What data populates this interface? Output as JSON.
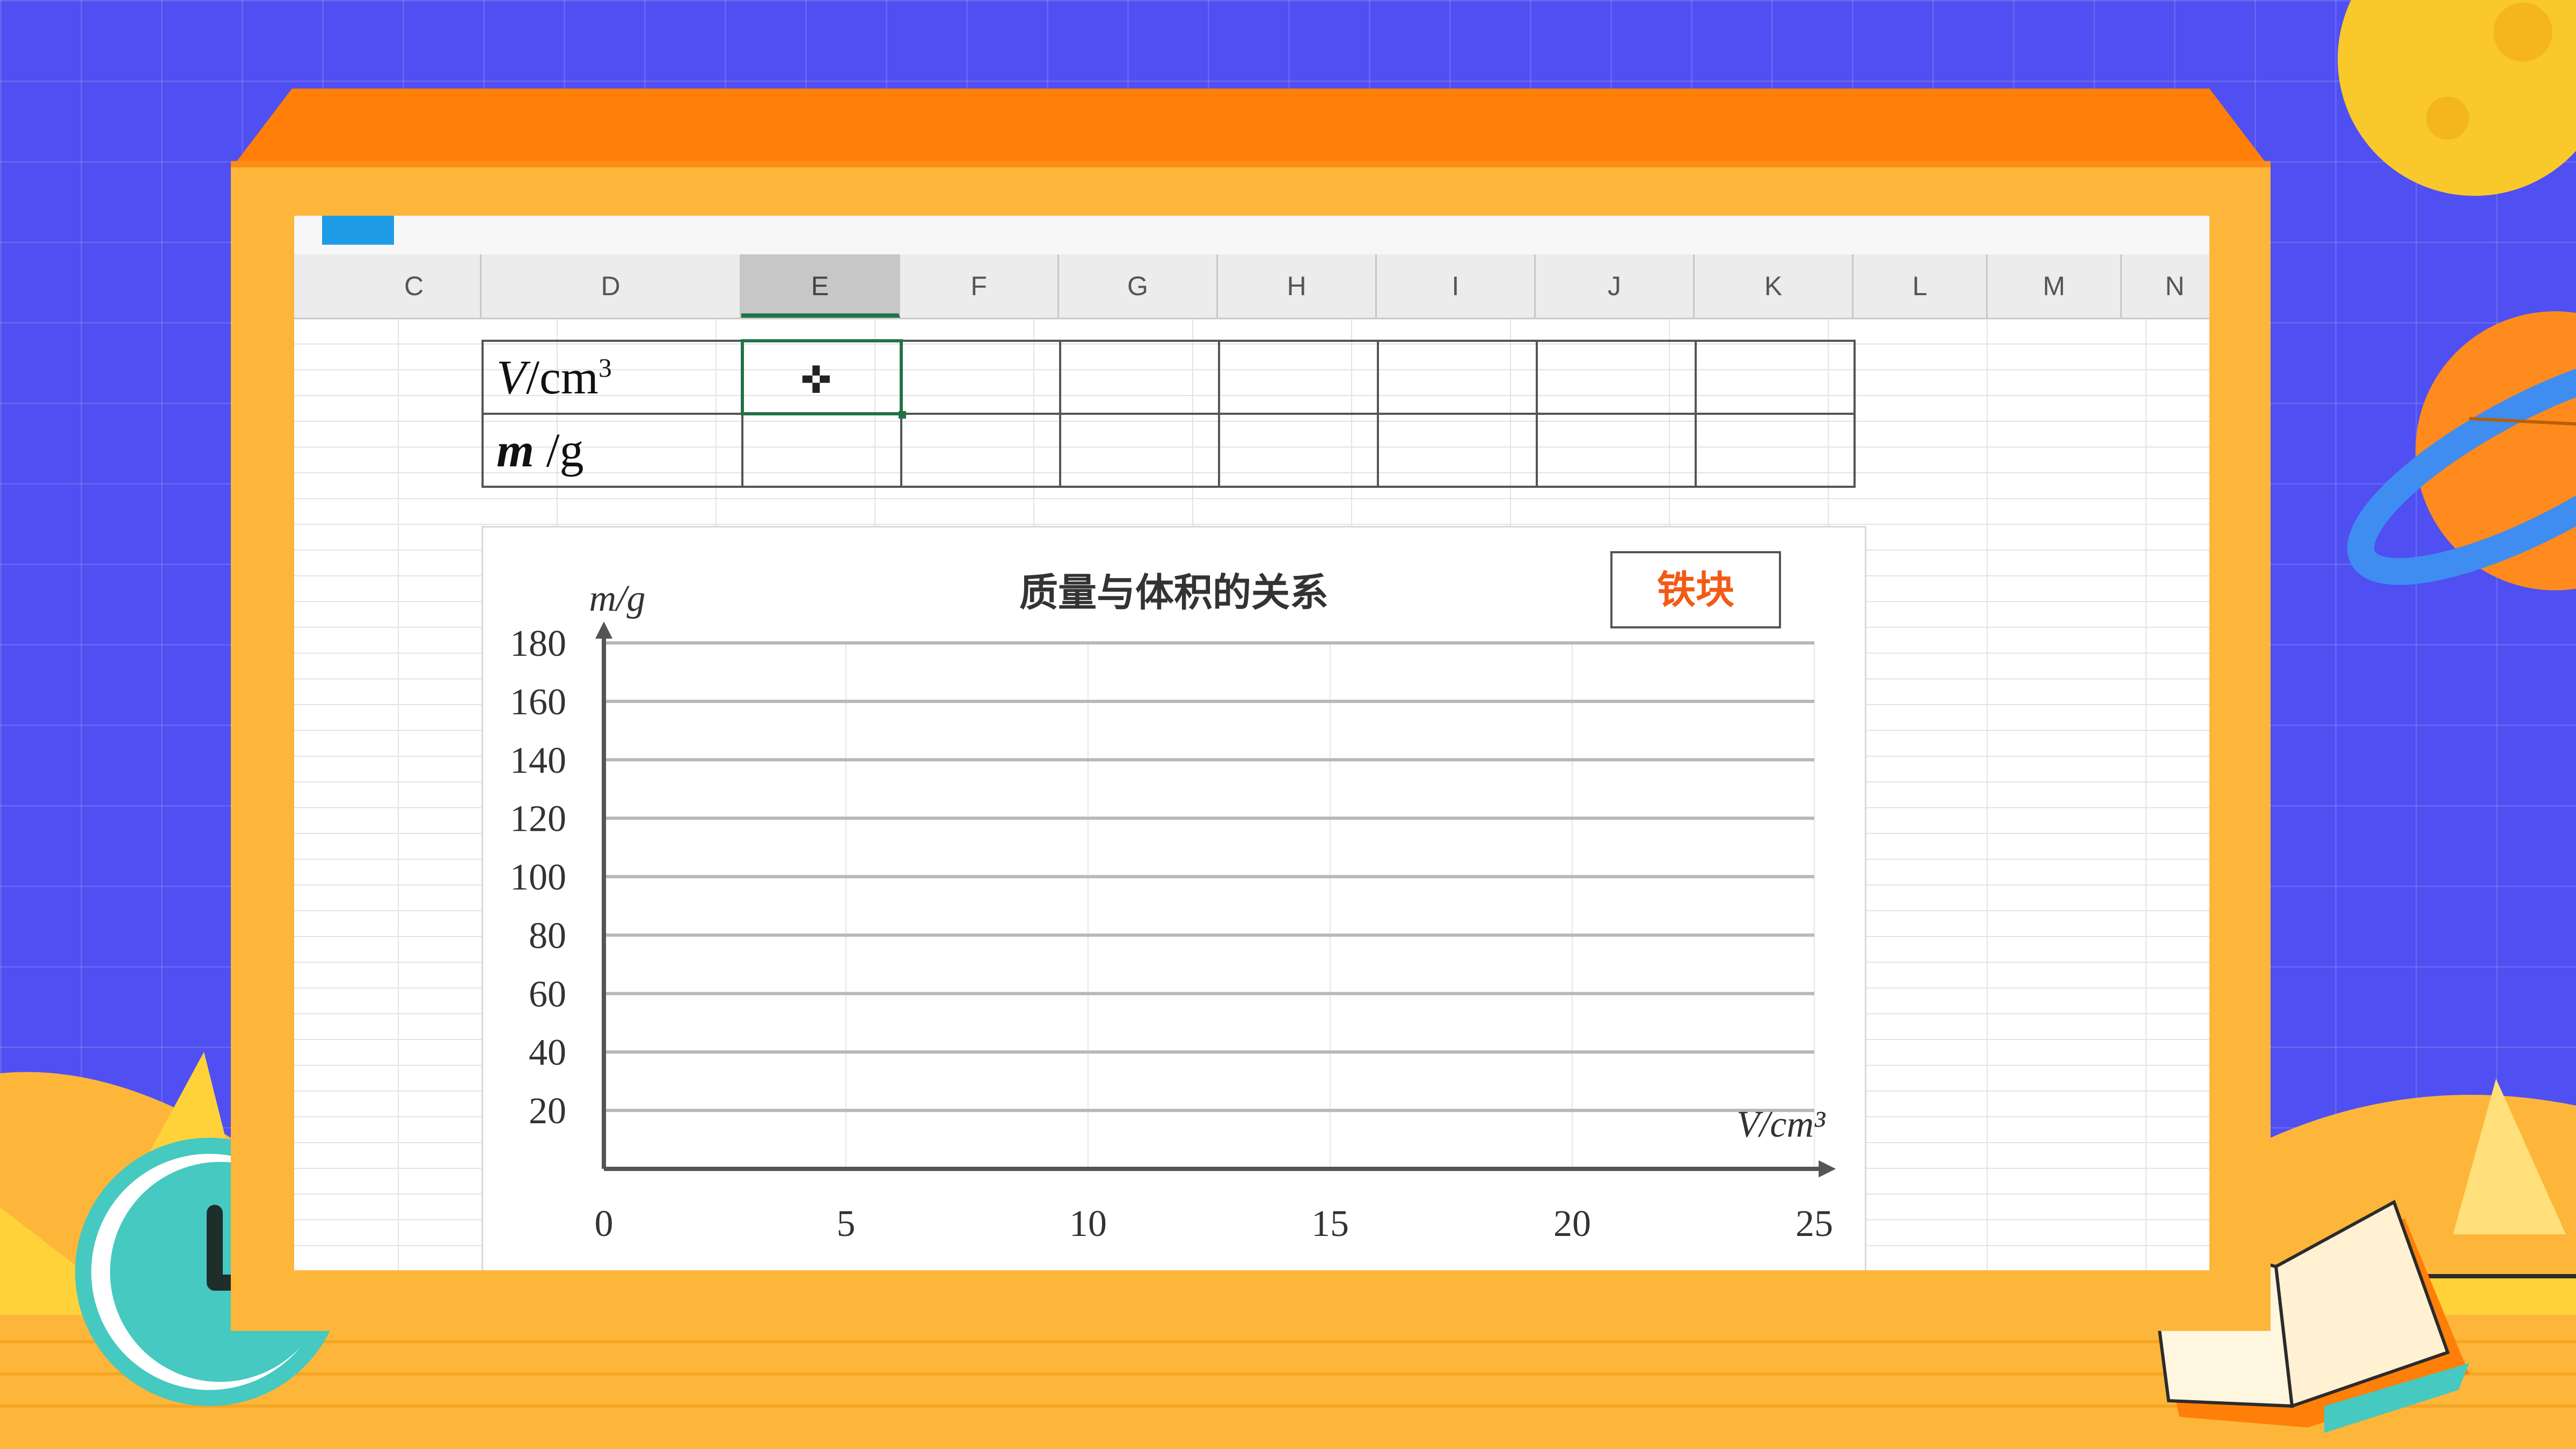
{
  "column_headers": [
    "C",
    "D",
    "E",
    "F",
    "G",
    "H",
    "I",
    "J",
    "K",
    "L",
    "M",
    "N"
  ],
  "active_column": "E",
  "data_table": {
    "row1_label": {
      "var": "V",
      "unit": "/cm",
      "exp": "3"
    },
    "row2_label": {
      "var": "m",
      "unit": " /g"
    },
    "cursor_icon": "cell-select-cross-icon"
  },
  "chart_data": {
    "type": "scatter",
    "title": "质量与体积的关系",
    "legend": [
      "铁块"
    ],
    "xlabel": "V/cm³",
    "ylabel": "m/g",
    "xlim": [
      0,
      25
    ],
    "ylim": [
      0,
      180
    ],
    "x_ticks": [
      0,
      5,
      10,
      15,
      20,
      25
    ],
    "y_ticks": [
      20,
      40,
      60,
      80,
      100,
      120,
      140,
      160,
      180
    ],
    "grid": "horizontal",
    "series": []
  },
  "colors": {
    "background": "#4f4ff2",
    "frame": "#fdb63a",
    "frame_top": "#ff7f09",
    "legend_text": "#f25a16",
    "selection": "#217346",
    "clock": "#45c9c1",
    "planet": "#ff8a1e",
    "moon": "#f9c82b"
  }
}
